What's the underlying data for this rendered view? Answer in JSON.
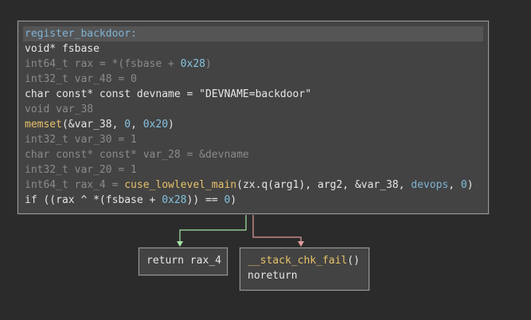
{
  "main_block": {
    "title": "register_backdoor:",
    "lines": [
      [
        {
          "t": "void* fsbase",
          "c": "kw"
        }
      ],
      [
        {
          "t": "int64_t rax = *(fsbase + ",
          "c": "dim"
        },
        {
          "t": "0x28",
          "c": "num"
        },
        {
          "t": ")",
          "c": "dim"
        }
      ],
      [
        {
          "t": "int32_t var_48 = 0",
          "c": "dim"
        }
      ],
      [
        {
          "t": "char const* const devname = \"DEVNAME=backdoor\"",
          "c": "kw"
        }
      ],
      [
        {
          "t": "void var_38",
          "c": "dim"
        }
      ],
      [
        {
          "t": "memset",
          "c": "fn"
        },
        {
          "t": "(&var_38, ",
          "c": "kw"
        },
        {
          "t": "0",
          "c": "num"
        },
        {
          "t": ", ",
          "c": "kw"
        },
        {
          "t": "0x20",
          "c": "num"
        },
        {
          "t": ")",
          "c": "kw"
        }
      ],
      [
        {
          "t": "int32_t var_30 = 1",
          "c": "dim"
        }
      ],
      [
        {
          "t": "char const* const* var_28 = &devname",
          "c": "dim"
        }
      ],
      [
        {
          "t": "int32_t var_20 = 1",
          "c": "dim"
        }
      ],
      [
        {
          "t": "int64_t rax_4 = ",
          "c": "dim"
        },
        {
          "t": "cuse_lowlevel_main",
          "c": "fn"
        },
        {
          "t": "(zx.q(arg1), arg2, &var_38, ",
          "c": "kw"
        },
        {
          "t": "devops",
          "c": "sym"
        },
        {
          "t": ", ",
          "c": "kw"
        },
        {
          "t": "0",
          "c": "num"
        },
        {
          "t": ")",
          "c": "kw"
        }
      ],
      [
        {
          "t": "if ((rax ^ *(fsbase + ",
          "c": "kw"
        },
        {
          "t": "0x28",
          "c": "num"
        },
        {
          "t": ")) == ",
          "c": "kw"
        },
        {
          "t": "0",
          "c": "num"
        },
        {
          "t": ")",
          "c": "kw"
        }
      ]
    ]
  },
  "ret_block": {
    "line": "return rax_4"
  },
  "fail_block": {
    "func": "__stack_chk_fail",
    "suffix": "()",
    "line2": "noreturn"
  },
  "colors": {
    "true_edge": "#a6e3a6",
    "false_edge": "#e39a9a",
    "background": "#2b2b2b",
    "block": "#434343"
  }
}
